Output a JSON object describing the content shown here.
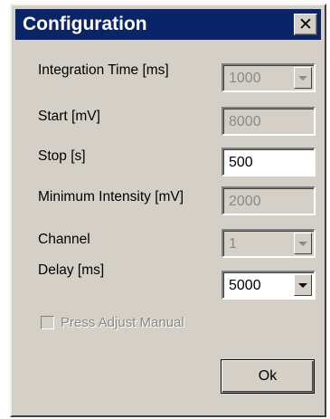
{
  "window": {
    "title": "Configuration",
    "close_symbol": "✕"
  },
  "fields": [
    {
      "label": "Integration Time [ms]",
      "value": "1000",
      "type": "dropdown",
      "enabled": false
    },
    {
      "label": "Start [mV]",
      "value": "8000",
      "type": "text",
      "enabled": false
    },
    {
      "label": "Stop [s]",
      "value": "500",
      "type": "text",
      "enabled": true
    },
    {
      "label": "Minimum Intensity [mV]",
      "value": "2000",
      "type": "text",
      "enabled": false
    },
    {
      "label": "Channel",
      "value": "1",
      "type": "dropdown",
      "enabled": false
    },
    {
      "label": "Delay [ms]",
      "value": "5000",
      "type": "dropdown",
      "enabled": true
    }
  ],
  "checkbox": {
    "label": "Press Adjust Manual",
    "checked": false,
    "enabled": false
  },
  "buttons": {
    "ok_label": "Ok"
  },
  "colors": {
    "titlebar": "#0a246a",
    "window_bg": "#d4d0c8",
    "disabled_text": "#8a8a8a"
  }
}
